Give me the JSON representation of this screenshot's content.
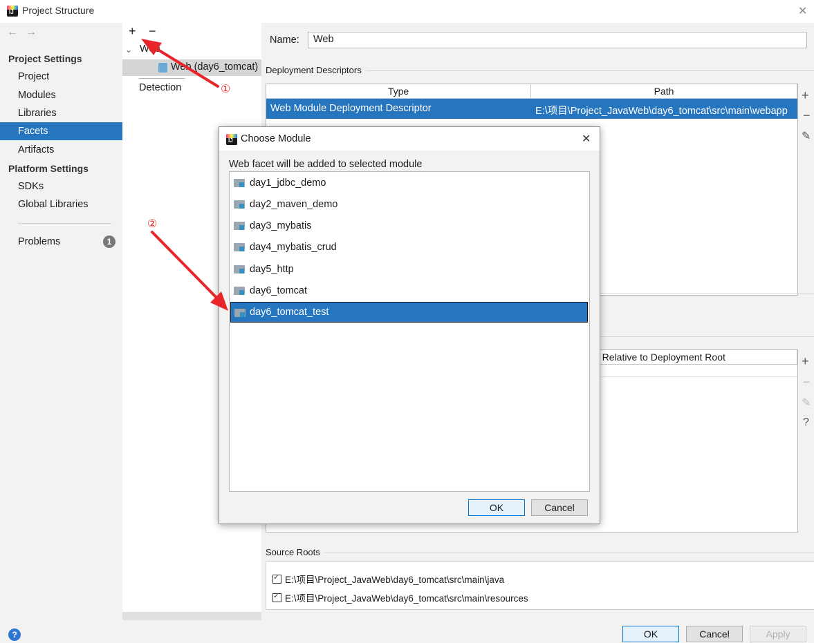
{
  "window": {
    "title": "Project Structure",
    "close_glyph": "✕"
  },
  "nav": {
    "back": "←",
    "forward": "→",
    "project_settings_header": "Project Settings",
    "project_items": [
      "Project",
      "Modules",
      "Libraries",
      "Facets",
      "Artifacts"
    ],
    "selected_item": "Facets",
    "platform_settings_header": "Platform Settings",
    "platform_items": [
      "SDKs",
      "Global Libraries"
    ],
    "problems_label": "Problems",
    "problems_count": "1"
  },
  "mid": {
    "add": "+",
    "remove": "−",
    "tree_root": "Web",
    "tree_child": "Web (day6_tomcat)",
    "detection": "Detection"
  },
  "right": {
    "name_label": "Name:",
    "name_value": "Web",
    "deployment_descriptors_title": "Deployment Descriptors",
    "dd_columns": [
      "Type",
      "Path"
    ],
    "dd_row": {
      "type": "Web Module Deployment Descriptor",
      "path": "E:\\项目\\Project_JavaWeb\\day6_tomcat\\src\\main\\webapp"
    },
    "web_resource_header": "h Relative to Deployment Root",
    "source_roots_title": "Source Roots",
    "source_roots": [
      "E:\\项目\\Project_JavaWeb\\day6_tomcat\\src\\main\\java",
      "E:\\项目\\Project_JavaWeb\\day6_tomcat\\src\\main\\resources"
    ]
  },
  "dialog": {
    "title": "Choose Module",
    "prompt": "Web facet will be added to selected module",
    "modules": [
      "day1_jdbc_demo",
      "day2_maven_demo",
      "day3_mybatis",
      "day4_mybatis_crud",
      "day5_http",
      "day6_tomcat",
      "day6_tomcat_test"
    ],
    "selected_index": 6,
    "ok": "OK",
    "cancel": "Cancel"
  },
  "footer": {
    "help": "?",
    "ok": "OK",
    "cancel": "Cancel",
    "apply": "Apply"
  },
  "annotations": {
    "marker1": "①",
    "marker2": "②"
  },
  "colors": {
    "selection": "#2675bf",
    "arrow": "#e8262a",
    "panel_bg": "#f2f2f2"
  }
}
